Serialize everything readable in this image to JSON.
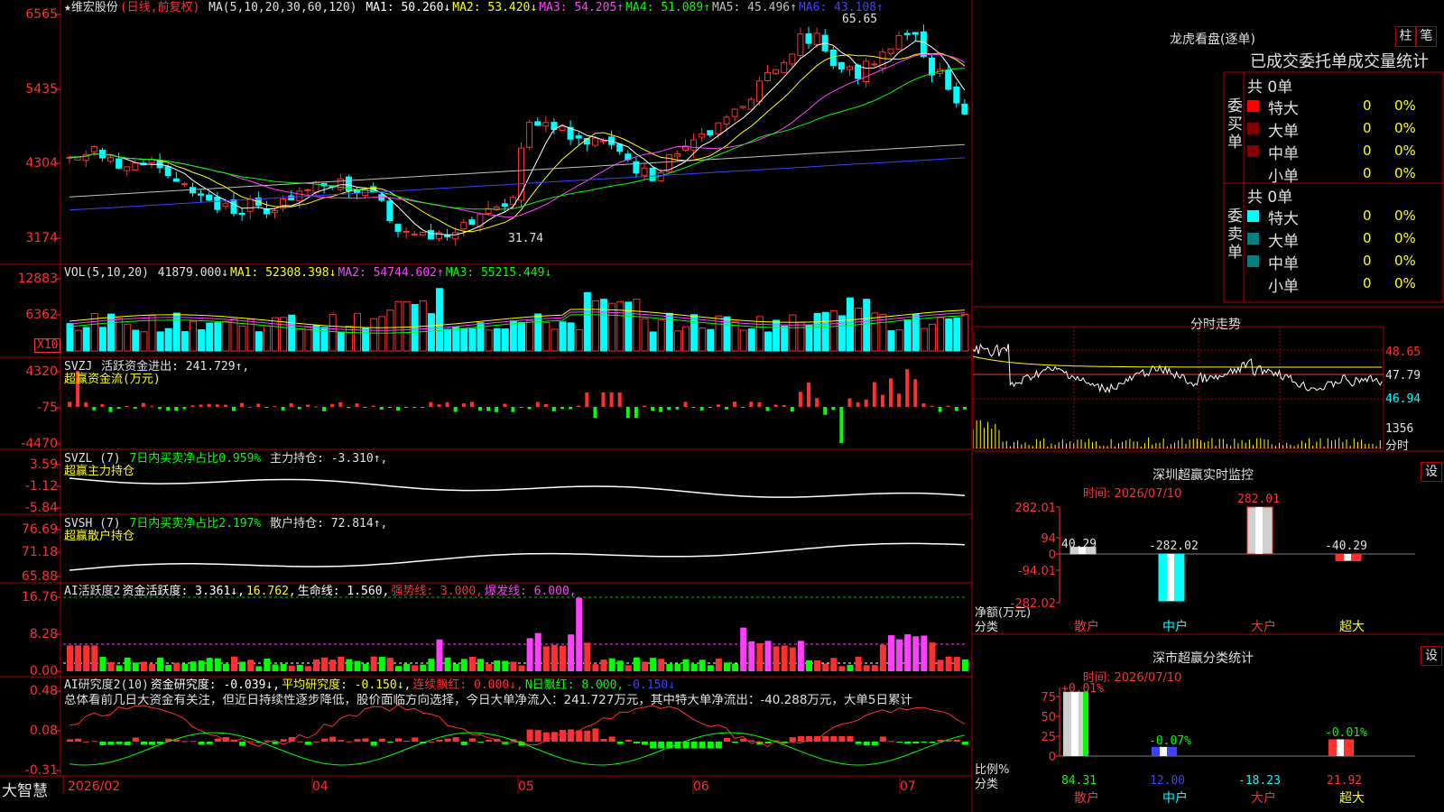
{
  "colors": {
    "up": "#ff3030",
    "down": "#00ffff",
    "volup": "#ff3030",
    "frame": "#b00000",
    "green": "#00ff00",
    "yellow": "#ffff00",
    "magenta": "#ff40ff",
    "white": "#ffffff",
    "blue": "#4040ff"
  },
  "main": {
    "title": "★维宏股份",
    "mode": "(日线,前复权)",
    "ma_params": "MA(5,10,20,30,60,120)",
    "ma_items": [
      {
        "label": "MA1: 50.260↓",
        "color": "#ffffff"
      },
      {
        "label": "MA2: 53.420↓",
        "color": "#ffff00"
      },
      {
        "label": "MA3: 54.205↑",
        "color": "#ff40ff"
      },
      {
        "label": "MA4: 51.089↑",
        "color": "#00ff00"
      },
      {
        "label": "MA5: 45.496↑",
        "color": "#c0c0c0"
      },
      {
        "label": "MA6: 43.108↑",
        "color": "#4040ff"
      }
    ],
    "y_ticks": [
      "6565",
      "5435",
      "4304",
      "3174"
    ],
    "high_label": "65.65",
    "low_label": "31.74"
  },
  "vol": {
    "header": "VOL(5,10,20)",
    "value": "41879.000↓",
    "items": [
      {
        "label": "MA1: 52308.398↓",
        "color": "#ffff00"
      },
      {
        "label": "MA2: 54744.602↑",
        "color": "#ff40ff"
      },
      {
        "label": "MA3: 55215.449↓",
        "color": "#00ff00"
      }
    ],
    "y_ticks": [
      "12883",
      "6362"
    ],
    "unit": "X10"
  },
  "svzj": {
    "header": "SVZJ",
    "label": "活跃资金进出: 241.729↑,",
    "sub": "超赢资金流(万元)",
    "y_ticks": [
      "4320",
      "-75",
      "-4470"
    ]
  },
  "svzl": {
    "header": "SVZL (7)",
    "label": "7日内买卖净占比0.959%",
    "label2": "主力持仓: -3.310↑,",
    "sub": "超赢主力持仓",
    "y_ticks": [
      "3.59",
      "-1.12",
      "-5.84"
    ]
  },
  "svsh": {
    "header": "SVSH (7)",
    "label": "7日内买卖净占比2.197%",
    "label2": "散户持仓: 72.814↑,",
    "sub": "超赢散户持仓",
    "y_ticks": [
      "76.69",
      "71.18",
      "65.88"
    ]
  },
  "ai1": {
    "header": "AI活跃度2",
    "items": [
      {
        "label": "资金活跃度: 3.361↓,",
        "color": "#ffffff"
      },
      {
        "label": "16.762,",
        "color": "#ffff00"
      },
      {
        "label": "生命线: 1.560,",
        "color": "#ffffff"
      },
      {
        "label": "强势线: 3.000,",
        "color": "#ff3030"
      },
      {
        "label": "爆发线: 6.000,",
        "color": "#ff40ff"
      }
    ],
    "y_ticks": [
      "16.76",
      "8.28",
      "0.00"
    ]
  },
  "ai2": {
    "header": "AI研究度2(10)",
    "items": [
      {
        "label": "资金研究度: -0.039↓,",
        "color": "#ffffff"
      },
      {
        "label": "平均研究度: -0.150↓,",
        "color": "#ffff00"
      },
      {
        "label": "连续飘红: 0.000↓,",
        "color": "#ff3030"
      },
      {
        "label": "N日飘红: 8.000,",
        "color": "#00ff00"
      },
      {
        "label": "-0.150↓",
        "color": "#4040ff"
      }
    ],
    "summary": "总体看前几日大资金有关注，但近日持续性逐步降低，股价面临方向选择，今日大单净流入：241.727万元，其中特大单净流出：-40.288万元，大单5日累计",
    "y_ticks": [
      "0.48",
      "0.08",
      "-0.31"
    ]
  },
  "xaxis": {
    "brand": "大智慧",
    "labels": [
      "2026/02",
      "04",
      "05",
      "06",
      "07"
    ]
  },
  "right": {
    "lhb_title": "龙虎看盘(逐单)",
    "btn1": "柱",
    "btn2": "笔",
    "stat_header": "已成交委托单成交量统计",
    "buy": {
      "side": "委买单",
      "total": "共 0单",
      "rows": [
        {
          "name": "特大",
          "count": "0",
          "pct": "0%",
          "color": "#ff0000"
        },
        {
          "name": "大单",
          "count": "0",
          "pct": "0%",
          "color": "#800000"
        },
        {
          "name": "中单",
          "count": "0",
          "pct": "0%",
          "color": "#800000"
        },
        {
          "name": "小单",
          "count": "0",
          "pct": "0%",
          "color": "#000000"
        }
      ]
    },
    "sell": {
      "side": "委卖单",
      "total": "共 0单",
      "rows": [
        {
          "name": "特大",
          "count": "0",
          "pct": "0%",
          "color": "#00ffff"
        },
        {
          "name": "大单",
          "count": "0",
          "pct": "0%",
          "color": "#008080"
        },
        {
          "name": "中单",
          "count": "0",
          "pct": "0%",
          "color": "#008080"
        },
        {
          "name": "小单",
          "count": "0",
          "pct": "0%",
          "color": "#000000"
        }
      ]
    },
    "intraday": {
      "title": "分时走势",
      "prices": [
        "48.65",
        "47.79",
        "46.94"
      ],
      "vol_label": "1356",
      "vol_sub": "分时"
    },
    "sz_monitor": {
      "title": "深圳超赢实时监控",
      "btn": "设",
      "time": "时间: 2026/07/10",
      "y_ticks": [
        "282.01",
        "94",
        "0",
        "-94.01",
        "-282.02"
      ],
      "ylab": "净额(万元)",
      "xcat": "分类",
      "categories": [
        "散户",
        "中户",
        "大户",
        "超大"
      ],
      "values": [
        40.29,
        -282.02,
        282.01,
        -40.29
      ],
      "value_labels": [
        "40.29",
        "-282.02",
        "282.01",
        "-40.29"
      ]
    },
    "sz_class": {
      "title": "深市超赢分类统计",
      "btn": "设",
      "time": "时间: 2026/07/10",
      "y_ticks": [
        "75",
        "50",
        "25",
        "0"
      ],
      "ylab": "比例%",
      "xcat": "分类",
      "categories": [
        "散户",
        "中户",
        "大户",
        "超大"
      ],
      "values": [
        84.31,
        12.0,
        -18.23,
        21.92
      ],
      "value_labels": [
        "84.31",
        "12.00",
        "-18.23",
        "21.92"
      ],
      "deltas": [
        "+0.01%",
        "-0.07%",
        "",
        "-0.01%"
      ]
    }
  }
}
